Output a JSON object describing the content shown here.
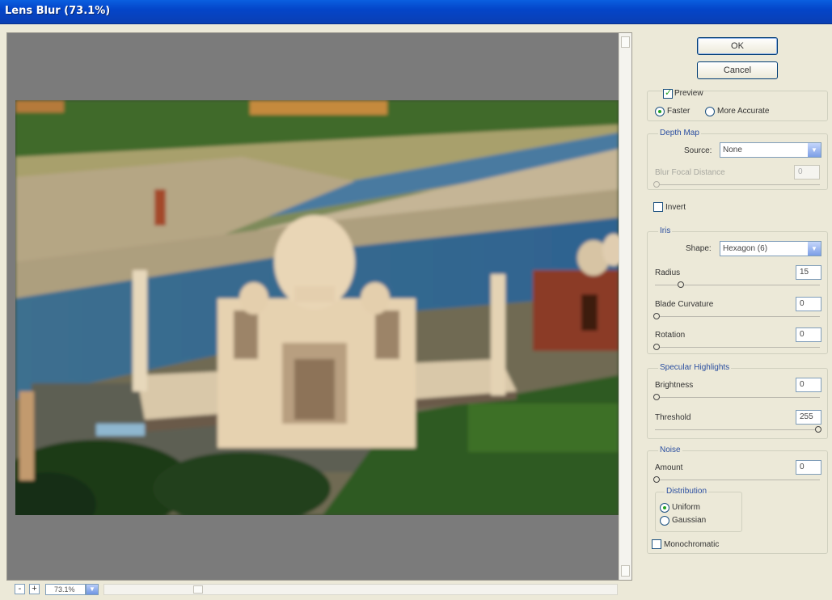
{
  "window": {
    "title": "Lens Blur (73.1%)"
  },
  "buttons": {
    "ok": "OK",
    "cancel": "Cancel"
  },
  "preview": {
    "checkbox_label": "Preview",
    "checked": true,
    "faster_label": "Faster",
    "more_accurate_label": "More Accurate",
    "selected": "Faster"
  },
  "depth_map": {
    "group_label": "Depth Map",
    "source_label": "Source:",
    "source_value": "None",
    "blur_focal_label": "Blur Focal Distance",
    "blur_focal_value": "0",
    "invert_label": "Invert",
    "invert_checked": false
  },
  "iris": {
    "group_label": "Iris",
    "shape_label": "Shape:",
    "shape_value": "Hexagon (6)",
    "radius_label": "Radius",
    "radius_value": "15",
    "blade_label": "Blade Curvature",
    "blade_value": "0",
    "rotation_label": "Rotation",
    "rotation_value": "0"
  },
  "specular": {
    "group_label": "Specular Highlights",
    "brightness_label": "Brightness",
    "brightness_value": "0",
    "threshold_label": "Threshold",
    "threshold_value": "255"
  },
  "noise": {
    "group_label": "Noise",
    "amount_label": "Amount",
    "amount_value": "0",
    "distribution_label": "Distribution",
    "uniform_label": "Uniform",
    "gaussian_label": "Gaussian",
    "selected": "Uniform",
    "monochromatic_label": "Monochromatic",
    "monochromatic_checked": false
  },
  "status": {
    "zoom_value": "73.1%",
    "zoom_out": "-",
    "zoom_in": "+"
  },
  "sliders": {
    "radius": 0.15,
    "blade": 0,
    "rotation": 0,
    "brightness": 0,
    "threshold": 1,
    "amount": 0,
    "blur_focal": 0
  }
}
